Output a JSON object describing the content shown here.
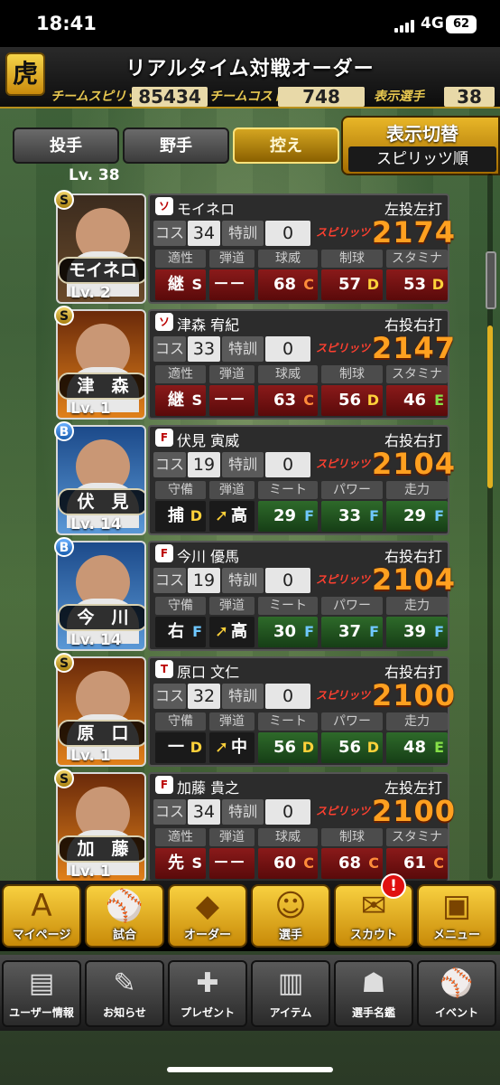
{
  "status": {
    "time": "18:41",
    "network": "4G",
    "battery": "62"
  },
  "header": {
    "title": "リアルタイム対戦オーダー",
    "logo": "虎",
    "team_spirits_label": "チームスピリッツ",
    "team_spirits_value": "85434",
    "team_cost_label": "チームコスト",
    "team_cost_value": "748",
    "display_players_label": "表示選手",
    "display_players_value": "38"
  },
  "tabs": [
    {
      "label": "投手",
      "active": false
    },
    {
      "label": "野手",
      "active": false
    },
    {
      "label": "控え",
      "active": true
    }
  ],
  "switch": {
    "label": "表示切替",
    "sort": "スピリッツ順"
  },
  "partial_top_level": "Lv. 38",
  "labels": {
    "cost": "コス",
    "training": "特訓",
    "spirits": "スピリッツ"
  },
  "players": [
    {
      "rank": "S",
      "card_name": "モイネロ",
      "level": "Lv. 2",
      "team": "ソ",
      "name": "モイネロ",
      "throw_bat": "左投左打",
      "cost": "34",
      "training": "0",
      "spirits": "2174",
      "attr_headers": [
        "適性",
        "弾道",
        "球威",
        "制球",
        "スタミナ"
      ],
      "attrs": [
        {
          "v": "継",
          "g": "S"
        },
        {
          "v": "－－－",
          "g": ""
        },
        {
          "v": "68",
          "g": "C"
        },
        {
          "v": "57",
          "g": "D"
        },
        {
          "v": "53",
          "g": "D"
        }
      ],
      "kind": "pitcher"
    },
    {
      "rank": "S",
      "card_name": "津　森",
      "level": "Lv. 1",
      "team": "ソ",
      "name": "津森 宥紀",
      "throw_bat": "右投右打",
      "cost": "33",
      "training": "0",
      "spirits": "2147",
      "attr_headers": [
        "適性",
        "弾道",
        "球威",
        "制球",
        "スタミナ"
      ],
      "attrs": [
        {
          "v": "継",
          "g": "S"
        },
        {
          "v": "－－－",
          "g": ""
        },
        {
          "v": "63",
          "g": "C"
        },
        {
          "v": "56",
          "g": "D"
        },
        {
          "v": "46",
          "g": "E"
        }
      ],
      "kind": "pitcher"
    },
    {
      "rank": "B",
      "card_name": "伏　見",
      "level": "Lv. 14",
      "team": "F",
      "name": "伏見 寅威",
      "throw_bat": "右投右打",
      "cost": "19",
      "training": "0",
      "spirits": "2104",
      "attr_headers": [
        "守備",
        "弾道",
        "ミート",
        "パワー",
        "走力"
      ],
      "attrs": [
        {
          "v": "捕",
          "g": "D"
        },
        {
          "v": "高",
          "g": "➚"
        },
        {
          "v": "29",
          "g": "F"
        },
        {
          "v": "33",
          "g": "F"
        },
        {
          "v": "29",
          "g": "F"
        }
      ],
      "kind": "fielder"
    },
    {
      "rank": "B",
      "card_name": "今　川",
      "level": "Lv. 14",
      "team": "F",
      "name": "今川 優馬",
      "throw_bat": "右投右打",
      "cost": "19",
      "training": "0",
      "spirits": "2104",
      "attr_headers": [
        "守備",
        "弾道",
        "ミート",
        "パワー",
        "走力"
      ],
      "attrs": [
        {
          "v": "右",
          "g": "F"
        },
        {
          "v": "高",
          "g": "➚"
        },
        {
          "v": "30",
          "g": "F"
        },
        {
          "v": "37",
          "g": "F"
        },
        {
          "v": "39",
          "g": "F"
        }
      ],
      "kind": "fielder"
    },
    {
      "rank": "S",
      "card_name": "原　口",
      "level": "Lv. 1",
      "team": "T",
      "name": "原口 文仁",
      "throw_bat": "右投右打",
      "cost": "32",
      "training": "0",
      "spirits": "2100",
      "attr_headers": [
        "守備",
        "弾道",
        "ミート",
        "パワー",
        "走力"
      ],
      "attrs": [
        {
          "v": "一",
          "g": "D"
        },
        {
          "v": "中",
          "g": "➚"
        },
        {
          "v": "56",
          "g": "D"
        },
        {
          "v": "56",
          "g": "D"
        },
        {
          "v": "48",
          "g": "E"
        }
      ],
      "kind": "fielder"
    },
    {
      "rank": "S",
      "card_name": "加　藤",
      "level": "Lv. 1",
      "team": "F",
      "name": "加藤 貴之",
      "throw_bat": "左投左打",
      "cost": "34",
      "training": "0",
      "spirits": "2100",
      "attr_headers": [
        "適性",
        "弾道",
        "球威",
        "制球",
        "スタミナ"
      ],
      "attrs": [
        {
          "v": "先",
          "g": "S"
        },
        {
          "v": "－－－",
          "g": ""
        },
        {
          "v": "60",
          "g": "C"
        },
        {
          "v": "68",
          "g": "C"
        },
        {
          "v": "61",
          "g": "C"
        }
      ],
      "kind": "pitcher"
    }
  ],
  "main_nav": [
    {
      "label": "マイページ",
      "icon": "A"
    },
    {
      "label": "試合",
      "icon": "⚾"
    },
    {
      "label": "オーダー",
      "icon": "◆"
    },
    {
      "label": "選手",
      "icon": "☺"
    },
    {
      "label": "スカウト",
      "icon": "✉"
    },
    {
      "label": "メニュー",
      "icon": "▣"
    }
  ],
  "scout_badge": "!",
  "sub_nav": [
    {
      "label": "ユーザー情報",
      "icon": "▤"
    },
    {
      "label": "お知らせ",
      "icon": "✎"
    },
    {
      "label": "プレゼント",
      "icon": "✚"
    },
    {
      "label": "アイテム",
      "icon": "▥"
    },
    {
      "label": "選手名鑑",
      "icon": "☗"
    },
    {
      "label": "イベント",
      "icon": "⚾"
    }
  ]
}
